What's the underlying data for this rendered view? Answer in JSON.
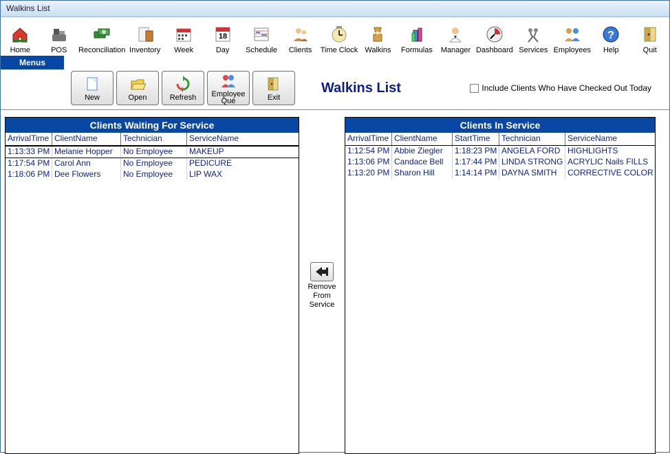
{
  "window_title": "Walkins List",
  "toolbar": [
    {
      "label": "Home",
      "icon": "home-icon"
    },
    {
      "label": "POS",
      "icon": "pos-icon"
    },
    {
      "label": "Reconciliation",
      "icon": "reconciliation-icon"
    },
    {
      "label": "Inventory",
      "icon": "inventory-icon"
    },
    {
      "label": "Week",
      "icon": "week-icon"
    },
    {
      "label": "Day",
      "icon": "day-icon"
    },
    {
      "label": "Schedule",
      "icon": "schedule-icon"
    },
    {
      "label": "Clients",
      "icon": "clients-icon"
    },
    {
      "label": "Time Clock",
      "icon": "timeclock-icon"
    },
    {
      "label": "Walkins",
      "icon": "walkins-icon"
    },
    {
      "label": "Formulas",
      "icon": "formulas-icon"
    },
    {
      "label": "Manager",
      "icon": "manager-icon"
    },
    {
      "label": "Dashboard",
      "icon": "dashboard-icon"
    },
    {
      "label": "Services",
      "icon": "services-icon"
    },
    {
      "label": "Employees",
      "icon": "employees-icon"
    },
    {
      "label": "Help",
      "icon": "help-icon"
    },
    {
      "label": "Quit",
      "icon": "quit-icon"
    }
  ],
  "menus_label": "Menus",
  "actions": [
    {
      "label": "New",
      "icon": "new-icon"
    },
    {
      "label": "Open",
      "icon": "open-icon"
    },
    {
      "label": "Refresh",
      "icon": "refresh-icon"
    },
    {
      "label": "Employee Que",
      "icon": "employeeque-icon"
    },
    {
      "label": "Exit",
      "icon": "exit-icon"
    }
  ],
  "page_title": "Walkins List",
  "include_checked_out_label": "Include Clients Who Have Checked Out Today",
  "remove_button_label": "Remove From Service",
  "waiting": {
    "title": "Clients Waiting For Service",
    "columns": [
      "ArrivalTime",
      "ClientName",
      "Technician",
      "ServiceName"
    ],
    "rows": [
      {
        "arrival": "1:13:33 PM",
        "client": "Melanie Hopper",
        "tech": "No Employee",
        "service": "MAKEUP"
      },
      {
        "arrival": "1:17:54 PM",
        "client": "Carol Ann",
        "tech": "No Employee",
        "service": "PEDICURE"
      },
      {
        "arrival": "1:18:06 PM",
        "client": "Dee Flowers",
        "tech": "No Employee",
        "service": "LIP WAX"
      }
    ]
  },
  "inservice": {
    "title": "Clients In Service",
    "columns": [
      "ArrivalTime",
      "ClientName",
      "StartTime",
      "Technician",
      "ServiceName"
    ],
    "rows": [
      {
        "arrival": "1:12:54 PM",
        "client": "Abbie Ziegler",
        "start": "1:18:23 PM",
        "tech": "ANGELA FORD",
        "service": "HIGHLIGHTS"
      },
      {
        "arrival": "1:13:06 PM",
        "client": "Candace Bell",
        "start": "1:17:44 PM",
        "tech": "LINDA STRONG",
        "service": "ACRYLIC Nails FILLS"
      },
      {
        "arrival": "1:13:20 PM",
        "client": "Sharon Hill",
        "start": "1:14:14 PM",
        "tech": "DAYNA SMITH",
        "service": "CORRECTIVE COLOR"
      }
    ]
  }
}
